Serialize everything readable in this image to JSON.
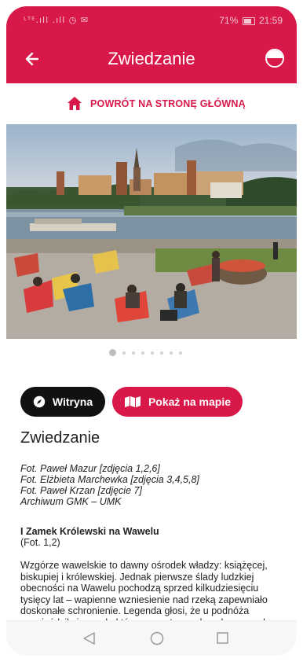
{
  "status_bar": {
    "signal": "ᴸᵀᴱ.ıll .ıll ◷ ✉",
    "battery": "71%",
    "time": "21:59"
  },
  "app_bar": {
    "title": "Zwiedzanie",
    "back_icon": "arrow-left-icon",
    "language_icon": "polish-flag-icon"
  },
  "home_link": {
    "label": "POWRÓT NA STRONĘ GŁÓWNĄ",
    "icon": "home-icon"
  },
  "carousel": {
    "slides": 8,
    "active_index": 0
  },
  "buttons": {
    "website_label": "Witryna",
    "map_label": "Pokaż na mapie"
  },
  "content": {
    "heading": "Zwiedzanie",
    "credits": [
      "Fot. Paweł Mazur [zdjęcia 1,2,6]",
      "Fot. Elżbieta Marchewka [zdjęcia 3,4,5,8]",
      "Fot. Paweł Krzan [zdjęcie 7]",
      "Archiwum GMK – UMK"
    ],
    "section_title": "I Zamek Królewski na Wawelu",
    "section_subtitle": "(Fot. 1,2)",
    "paragraph": "Wzgórze wawelskie to dawny ośrodek władzy: książęcej, biskupiej i królewskiej. Jednak pierwsze ślady ludzkiej obecności na Wawelu pochodzą sprzed kilkudziesięciu tysięcy lat – wapienne wzniesienie nad rzeką zapewniało doskonałe schronienie. Legenda głosi, że u podnóża zagnieździł się smok, którego sprytem pokonał szewczyk"
  },
  "colors": {
    "brand": "#d81848",
    "dark_button": "#111111"
  }
}
